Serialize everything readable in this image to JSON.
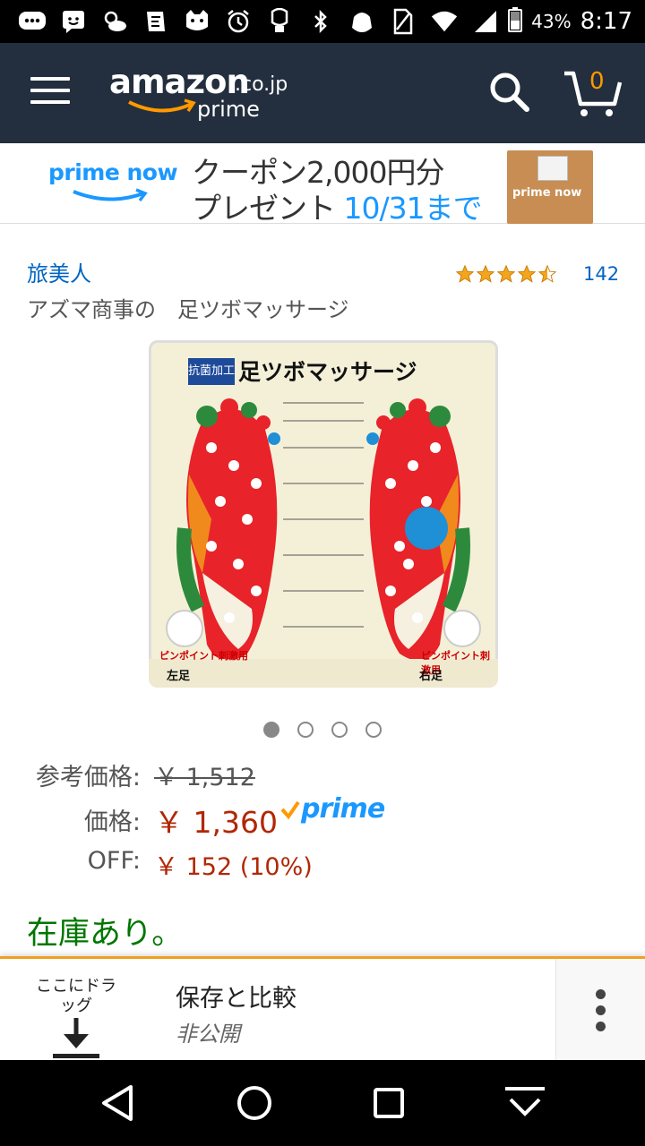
{
  "status_bar": {
    "battery_pct": "43%",
    "time": "8:17",
    "icons": [
      "chat-icon",
      "message-icon",
      "weather-icon",
      "app-icon",
      "cat-icon",
      "alarm-icon",
      "bulb-icon",
      "bluetooth-icon",
      "bag-icon",
      "no-sim-icon",
      "wifi-icon",
      "signal-icon",
      "battery-icon"
    ]
  },
  "header": {
    "logo_main": "amazon",
    "logo_tld": ".co.jp",
    "logo_sub": "prime",
    "cart_count": "0",
    "icons": [
      "menu-icon",
      "search-icon",
      "cart-icon"
    ]
  },
  "banner": {
    "brand": "prime now",
    "line1": "クーポン2,000円分",
    "line2_prefix": "プレゼント",
    "line2_date": "10/31まで",
    "bag_label": "prime now"
  },
  "product": {
    "brand": "旅美人",
    "rating": 4.5,
    "rating_count": "142",
    "title": "アズマ商事の　足ツボマッサージ",
    "image": {
      "title": "足ツボマッサージ",
      "badge": "抗菌加工",
      "left_label": "左足",
      "right_label": "右足",
      "pin_label": "ピンポイント刺激用"
    },
    "image_count": 4,
    "active_image": 0
  },
  "prices": {
    "list_label": "参考価格:",
    "list_value": "￥ 1,512",
    "price_label": "価格:",
    "price_value": "￥ 1,360",
    "prime_badge": "prime",
    "off_label": "OFF:",
    "off_value": "￥ 152 (10%)"
  },
  "availability": "在庫あり。",
  "bottom_panel": {
    "drag_label": "ここにドラッグ",
    "save_title": "保存と比較",
    "save_sub": "非公開"
  },
  "colors": {
    "header_bg": "#232f3e",
    "price_red": "#b12704",
    "stock_green": "#007600",
    "link_blue": "#0066c0",
    "prime_blue": "#1a98ff",
    "accent_orange": "#ff9900"
  }
}
